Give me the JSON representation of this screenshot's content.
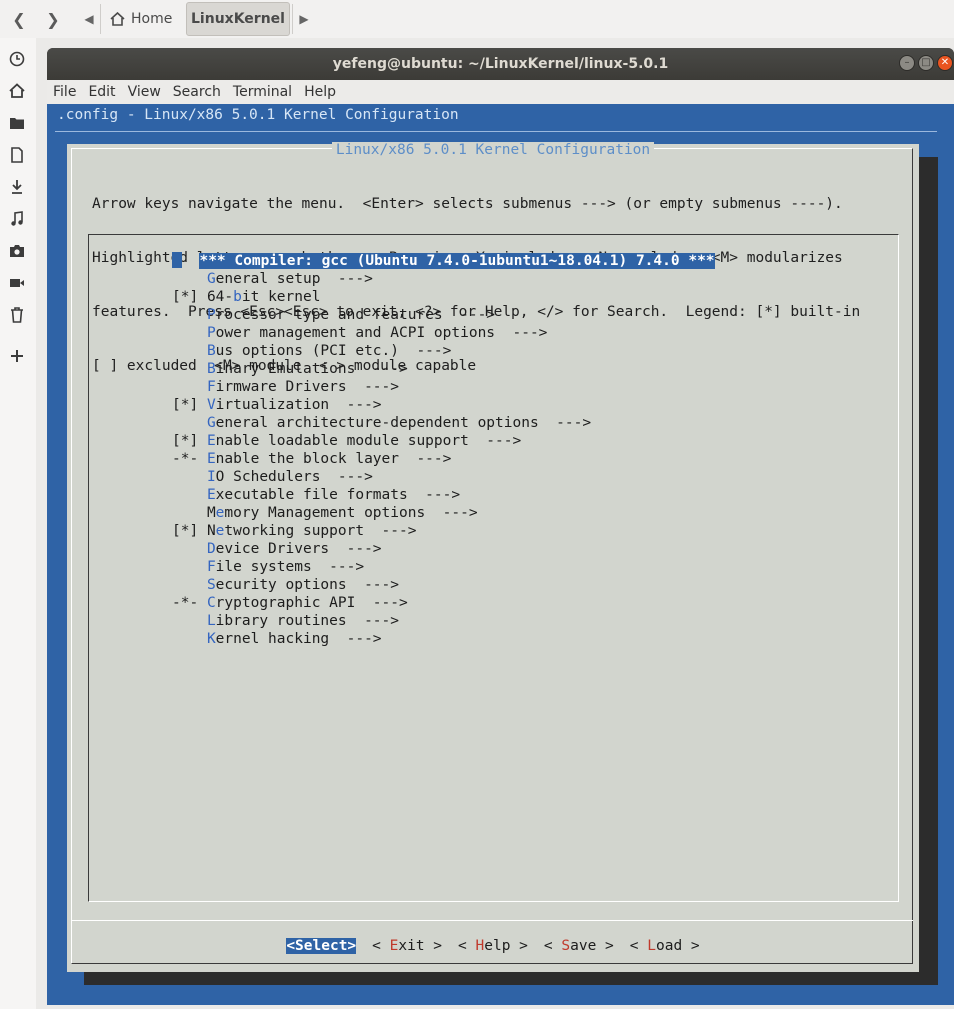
{
  "filemanager": {
    "crumbs": {
      "home": "Home",
      "current": "LinuxKernel"
    }
  },
  "terminal": {
    "title": "yefeng@ubuntu: ~/LinuxKernel/linux-5.0.1",
    "menu": [
      "File",
      "Edit",
      "View",
      "Search",
      "Terminal",
      "Help"
    ]
  },
  "kconfig": {
    "window_title": ".config - Linux/x86 5.0.1 Kernel Configuration",
    "dialog_title": "Linux/x86 5.0.1 Kernel Configuration",
    "help": [
      "Arrow keys navigate the menu.  <Enter> selects submenus ---> (or empty submenus ----).",
      "Highlighted letters are hotkeys.  Pressing <Y> includes, <N> excludes, <M> modularizes",
      "features.  Press <Esc><Esc> to exit, <?> for Help, </> for Search.  Legend: [*] built-in",
      "[ ] excluded  <M> module  < > module capable"
    ],
    "items": [
      {
        "prefix": "   ",
        "pre": "*** Compiler: gcc (Ubuntu 7.4.0-1ubuntu1~18.04.1) 7.4.0 ***",
        "hot": "",
        "post": "",
        "selected": true
      },
      {
        "prefix": "   ",
        "pre": "",
        "hot": "G",
        "post": "eneral setup  --->"
      },
      {
        "prefix": "[*]",
        "pre": "64-",
        "hot": "b",
        "post": "it kernel"
      },
      {
        "prefix": "   ",
        "pre": "",
        "hot": "P",
        "post": "rocessor type and features  --->"
      },
      {
        "prefix": "   ",
        "pre": "",
        "hot": "P",
        "post": "ower management and ACPI options  --->"
      },
      {
        "prefix": "   ",
        "pre": "",
        "hot": "B",
        "post": "us options (PCI etc.)  --->"
      },
      {
        "prefix": "   ",
        "pre": "",
        "hot": "B",
        "post": "inary Emulations  --->"
      },
      {
        "prefix": "   ",
        "pre": "",
        "hot": "F",
        "post": "irmware Drivers  --->"
      },
      {
        "prefix": "[*]",
        "pre": "",
        "hot": "V",
        "post": "irtualization  --->"
      },
      {
        "prefix": "   ",
        "pre": "",
        "hot": "G",
        "post": "eneral architecture-dependent options  --->"
      },
      {
        "prefix": "[*]",
        "pre": "",
        "hot": "E",
        "post": "nable loadable module support  --->"
      },
      {
        "prefix": "-*-",
        "pre": "",
        "hot": "E",
        "post": "nable the block layer  --->"
      },
      {
        "prefix": "   ",
        "pre": "",
        "hot": "I",
        "post": "O Schedulers  --->"
      },
      {
        "prefix": "   ",
        "pre": "",
        "hot": "E",
        "post": "xecutable file formats  --->"
      },
      {
        "prefix": "   ",
        "pre": "M",
        "hot": "e",
        "post": "mory Management options  --->"
      },
      {
        "prefix": "[*]",
        "pre": "N",
        "hot": "e",
        "post": "tworking support  --->"
      },
      {
        "prefix": "   ",
        "pre": "",
        "hot": "D",
        "post": "evice Drivers  --->"
      },
      {
        "prefix": "   ",
        "pre": "",
        "hot": "F",
        "post": "ile systems  --->"
      },
      {
        "prefix": "   ",
        "pre": "",
        "hot": "S",
        "post": "ecurity options  --->"
      },
      {
        "prefix": "-*-",
        "pre": "",
        "hot": "C",
        "post": "ryptographic API  --->"
      },
      {
        "prefix": "   ",
        "pre": "",
        "hot": "L",
        "post": "ibrary routines  --->"
      },
      {
        "prefix": "   ",
        "pre": "",
        "hot": "K",
        "post": "ernel hacking  --->"
      }
    ],
    "buttons": [
      {
        "pre": "",
        "hot": "",
        "label": "<Select>",
        "post": "",
        "active": true
      },
      {
        "pre": "< ",
        "hot": "E",
        "label": "xit",
        "post": " >"
      },
      {
        "pre": "< ",
        "hot": "H",
        "label": "elp",
        "post": " >"
      },
      {
        "pre": "< ",
        "hot": "S",
        "label": "ave",
        "post": " >"
      },
      {
        "pre": "< ",
        "hot": "L",
        "label": "oad",
        "post": " >"
      }
    ]
  }
}
